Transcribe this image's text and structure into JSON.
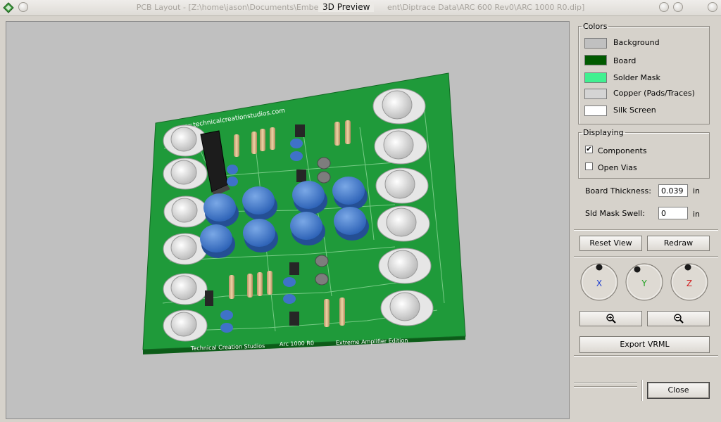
{
  "window": {
    "background_title": "PCB Layout - [Z:\\home\\jason\\Documents\\Embeded                      ent\\Diptrace Data\\ARC 600 Rev0\\ARC 1000 R0.dip]",
    "dialog_title": "3D Preview"
  },
  "board": {
    "url_text": "www.technicalcreationstudios.com",
    "footer_left": "Technical Creation Studios",
    "footer_mid": "Arc 1000 R0",
    "footer_right": "Extreme Amplifier Edition"
  },
  "colors": {
    "group_label": "Colors",
    "items": [
      {
        "label": "Background",
        "color": "#c0c0c0"
      },
      {
        "label": "Board",
        "color": "#005a00"
      },
      {
        "label": "Solder Mask",
        "color": "#40f090"
      },
      {
        "label": "Copper (Pads/Traces)",
        "color": "#d4d4d4"
      },
      {
        "label": "Silk Screen",
        "color": "#ffffff"
      }
    ]
  },
  "displaying": {
    "group_label": "Displaying",
    "components": {
      "label": "Components",
      "checked": true,
      "mark": "✔"
    },
    "open_vias": {
      "label": "Open Vias",
      "checked": false
    }
  },
  "board_thickness": {
    "label": "Board Thickness:",
    "value": "0.039",
    "unit": "in"
  },
  "sld_mask_swell": {
    "label": "Sld Mask Swell:",
    "value": "0",
    "unit": "in"
  },
  "buttons": {
    "reset_view": "Reset View",
    "redraw": "Redraw",
    "export_vrml": "Export VRML",
    "close": "Close"
  },
  "rotation": {
    "x_label": "X",
    "y_label": "Y",
    "z_label": "Z",
    "x_color": "#2040d0",
    "y_color": "#20a020",
    "z_color": "#d02020"
  }
}
